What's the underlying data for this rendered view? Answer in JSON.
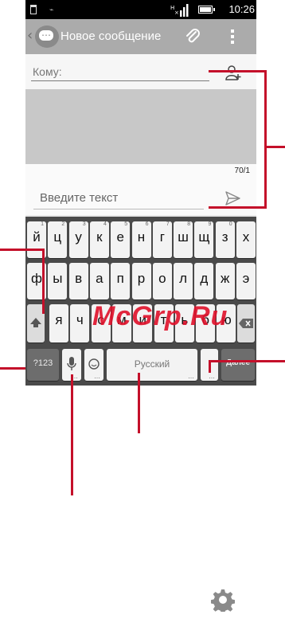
{
  "status_bar": {
    "time": "10:26"
  },
  "action_bar": {
    "title": "Новое сообщение",
    "back": "‹"
  },
  "recipient": {
    "placeholder": "Кому:"
  },
  "counter": "70/1",
  "message": {
    "placeholder": "Введите текст"
  },
  "keyboard": {
    "row1": [
      {
        "label": "й",
        "hint": "1"
      },
      {
        "label": "ц",
        "hint": "2"
      },
      {
        "label": "у",
        "hint": "3"
      },
      {
        "label": "к",
        "hint": "4"
      },
      {
        "label": "е",
        "hint": "5"
      },
      {
        "label": "н",
        "hint": "6"
      },
      {
        "label": "г",
        "hint": "7"
      },
      {
        "label": "ш",
        "hint": "8"
      },
      {
        "label": "щ",
        "hint": "9"
      },
      {
        "label": "з",
        "hint": "0"
      },
      {
        "label": "х",
        "hint": ""
      }
    ],
    "row2": [
      "ф",
      "ы",
      "в",
      "а",
      "п",
      "р",
      "о",
      "л",
      "д",
      "ж",
      "э"
    ],
    "row3": [
      "я",
      "ч",
      "с",
      "м",
      "и",
      "т",
      "ь",
      "б",
      "ю"
    ],
    "symbols": "?123",
    "space": "Русский",
    "next": "Далее"
  },
  "watermark": "McGrp.Ru",
  "colors": {
    "action_bar": "#ababab",
    "callout": "#c4102a",
    "watermark": "#e0102a"
  },
  "icons": [
    "attach-icon",
    "overflow-menu-icon",
    "add-contact-icon",
    "send-icon",
    "shift-icon",
    "backspace-icon",
    "microphone-icon",
    "emoji-icon",
    "gear-icon"
  ]
}
